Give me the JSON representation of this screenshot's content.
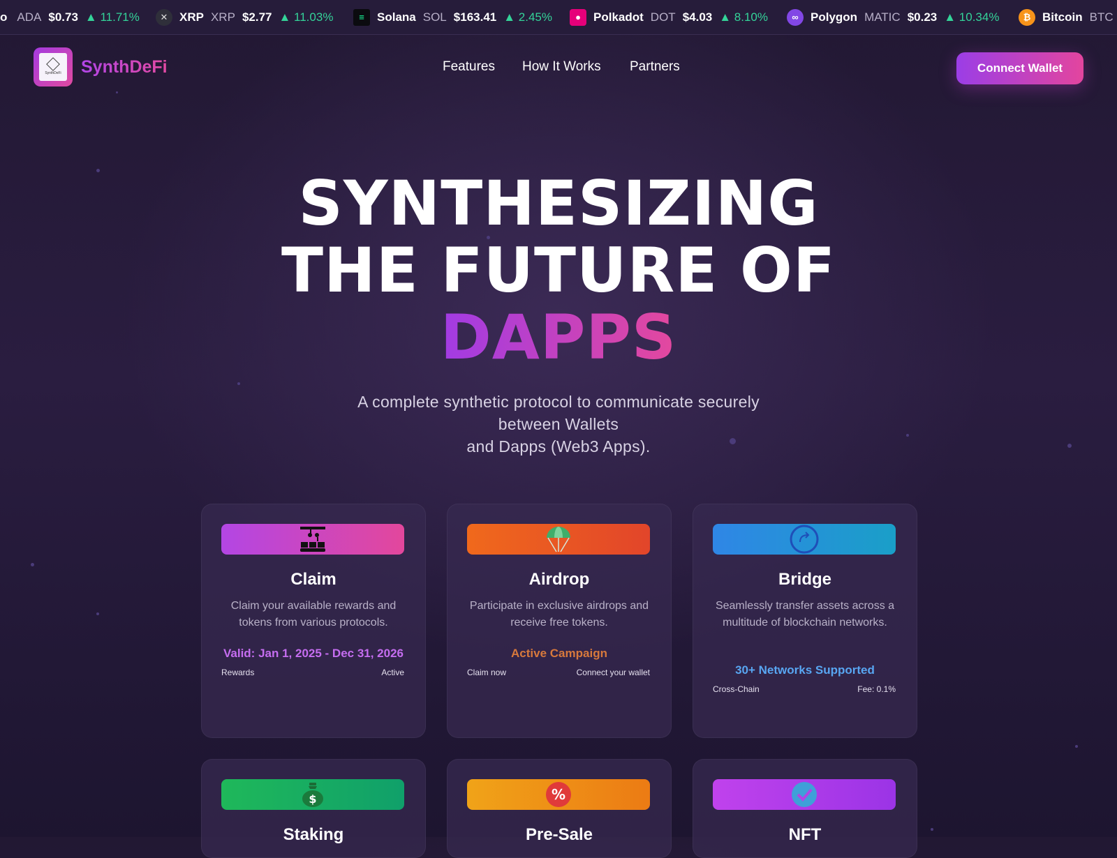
{
  "ticker": [
    {
      "name": "",
      "symbol": "ADA",
      "price": "$0.73",
      "change": "▲ 11.71%",
      "icon": "cardano-icon",
      "icon_color": "#3b4fd1",
      "partial_name": "o"
    },
    {
      "name": "XRP",
      "symbol": "XRP",
      "price": "$2.77",
      "change": "▲ 11.03%",
      "icon": "xrp-icon",
      "icon_color": "#2f2f3a"
    },
    {
      "name": "Solana",
      "symbol": "SOL",
      "price": "$163.41",
      "change": "▲ 2.45%",
      "icon": "solana-icon",
      "icon_color": "#0b0b0f"
    },
    {
      "name": "Polkadot",
      "symbol": "DOT",
      "price": "$4.03",
      "change": "▲ 8.10%",
      "icon": "polkadot-icon",
      "icon_color": "#e6007a"
    },
    {
      "name": "Polygon",
      "symbol": "MATIC",
      "price": "$0.23",
      "change": "▲ 10.34%",
      "icon": "polygon-icon",
      "icon_color": "#8247e5"
    },
    {
      "name": "Bitcoin",
      "symbol": "BTC",
      "price": "",
      "change": "",
      "icon": "bitcoin-icon",
      "icon_color": "#f7931a"
    }
  ],
  "header": {
    "brand": "SynthDeFi",
    "logo_text": "SynthDeFi",
    "nav": [
      "Features",
      "How It Works",
      "Partners"
    ],
    "connect_label": "Connect Wallet"
  },
  "hero": {
    "line1": "SYNTHESIZING",
    "line2": "THE FUTURE OF",
    "line3": "DAPPS",
    "subtitle_line1": "A complete synthetic protocol to communicate securely",
    "subtitle_line2": "between Wallets",
    "subtitle_line3": "and Dapps (Web3 Apps)."
  },
  "cards": [
    {
      "title": "Claim",
      "desc": "Claim your available rewards and tokens from various protocols.",
      "highlight": "Valid: Jan 1, 2025 - Dec 31, 2026",
      "foot_left": "Rewards",
      "foot_right": "Active",
      "icon": "conveyor-icon",
      "accent": "#c56df0",
      "gradient": [
        "#b346e4",
        "#e3479c"
      ]
    },
    {
      "title": "Airdrop",
      "desc": "Participate in exclusive airdrops and receive free tokens.",
      "highlight": "Active Campaign",
      "foot_left": "Claim now",
      "foot_right": "Connect your wallet",
      "icon": "parachute-icon",
      "accent": "#d7793c",
      "gradient": [
        "#f0691c",
        "#e2452a"
      ]
    },
    {
      "title": "Bridge",
      "desc": "Seamlessly transfer assets across a multitude of blockchain networks.",
      "highlight": "30+ Networks Supported",
      "foot_left": "Cross-Chain",
      "foot_right": "Fee: 0.1%",
      "icon": "bridge-arrow-icon",
      "accent": "#58a6f2",
      "gradient": [
        "#2f86e6",
        "#1a9fc8"
      ]
    },
    {
      "title": "Staking",
      "icon": "money-bag-icon",
      "gradient": [
        "#1fb85a",
        "#10a06a"
      ]
    },
    {
      "title": "Pre-Sale",
      "icon": "percent-badge-icon",
      "gradient": [
        "#f0a318",
        "#ec7b14"
      ]
    },
    {
      "title": "NFT",
      "icon": "verified-check-icon",
      "gradient": [
        "#c042ec",
        "#9b34e6"
      ]
    }
  ]
}
